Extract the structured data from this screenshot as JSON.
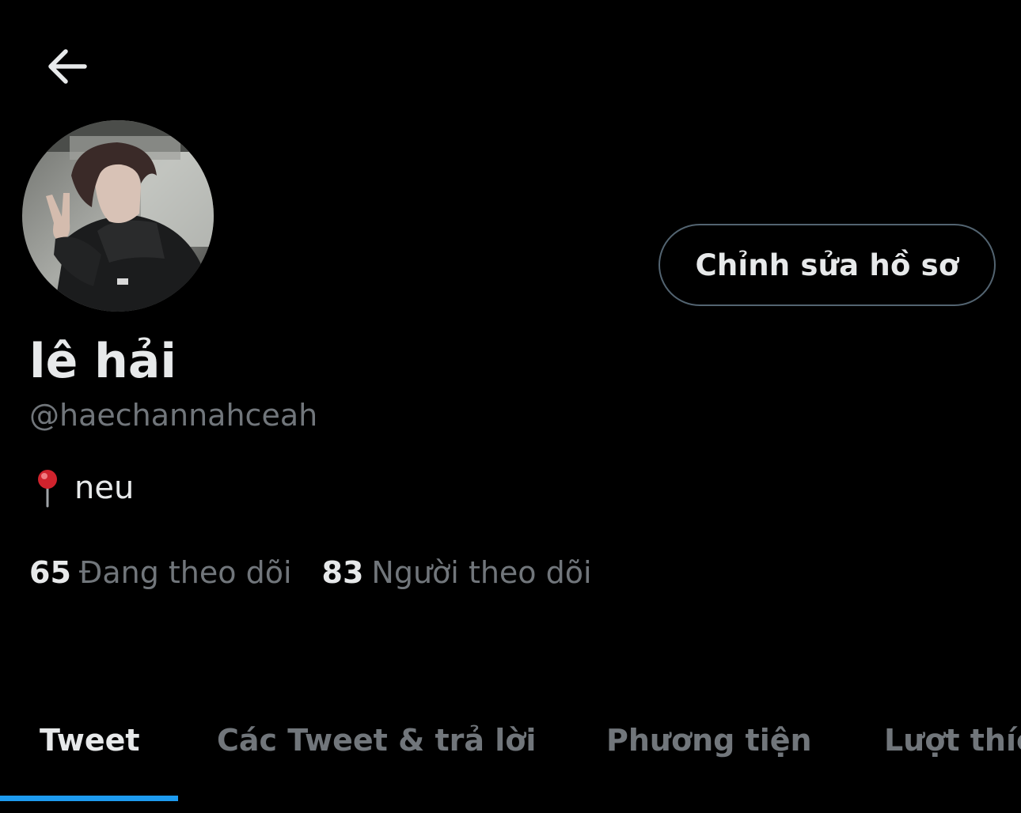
{
  "header": {
    "back_icon": "arrow-left-icon"
  },
  "profile": {
    "avatar_alt": "avatar",
    "display_name": "lê hải",
    "handle": "@haechannahceah",
    "bio_icon": "round-pushpin-icon",
    "bio_text": "neu",
    "edit_button_label": "Chỉnh sửa hồ sơ"
  },
  "stats": {
    "following_count": "65",
    "following_label": "Đang theo dõi",
    "followers_count": "83",
    "followers_label": "Người theo dõi"
  },
  "tabs": [
    {
      "label": "Tweet",
      "active": true
    },
    {
      "label": "Các Tweet & trả lời",
      "active": false
    },
    {
      "label": "Phương tiện",
      "active": false
    },
    {
      "label": "Lượt thích",
      "active": false
    }
  ],
  "colors": {
    "background": "#000000",
    "primary_text": "#e7e9ea",
    "secondary_text": "#71767b",
    "accent": "#1d9bf0",
    "border": "#536471"
  }
}
